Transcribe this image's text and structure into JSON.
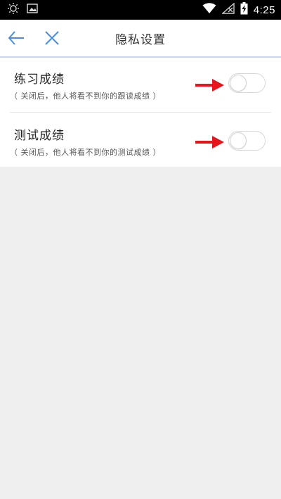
{
  "status_bar": {
    "time": "4:25",
    "icons": [
      "brightness-icon",
      "image-icon",
      "wifi-icon",
      "no-signal-icon",
      "battery-charging-icon"
    ]
  },
  "header": {
    "title": "隐私设置",
    "back_icon": "arrow-left-icon",
    "close_icon": "close-icon",
    "accent": "#4a8fdc"
  },
  "settings": {
    "items": [
      {
        "title": "练习成绩",
        "desc": "（ 关闭后，他人将看不到你的跟读成绩 ）",
        "enabled": false
      },
      {
        "title": "测试成绩",
        "desc": "（ 关闭后，他人将看不到你的测试成绩 ）",
        "enabled": false
      }
    ]
  },
  "colors": {
    "annotation_arrow": "#e8141c",
    "page_background": "#efefef"
  }
}
